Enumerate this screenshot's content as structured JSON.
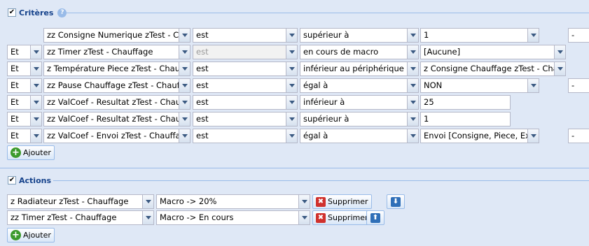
{
  "criteres": {
    "title": "Critères",
    "help_icon": "?",
    "rows": [
      {
        "op": "",
        "var": "zz Consigne Numerique zTest - Ch",
        "comp": "est",
        "cond": "supérieur à",
        "val": "1",
        "extra": "-"
      },
      {
        "op": "Et",
        "var": "zz Timer zTest - Chauffage",
        "comp": "est",
        "cond": "en cours de macro",
        "val": "[Aucune]",
        "extra": ""
      },
      {
        "op": "Et",
        "var": "z Température Piece zTest - Chau",
        "comp": "est",
        "cond": "inférieur au périphérique",
        "val": "z Consigne Chauffage zTest - Chau",
        "extra": ""
      },
      {
        "op": "Et",
        "var": "zz Pause Chauffage zTest - Chauff",
        "comp": "est",
        "cond": "égal à",
        "val": "NON",
        "extra": "-"
      },
      {
        "op": "Et",
        "var": "zz ValCoef - Resultat zTest - Chau",
        "comp": "est",
        "cond": "inférieur à",
        "val": "25",
        "extra": ""
      },
      {
        "op": "Et",
        "var": "zz ValCoef - Resultat zTest - Chau",
        "comp": "est",
        "cond": "supérieur à",
        "val": "1",
        "extra": ""
      },
      {
        "op": "Et",
        "var": "zz ValCoef - Envoi zTest - Chauffac",
        "comp": "est",
        "cond": "égal à",
        "val": "Envoi [Consigne, Piece, Ex",
        "extra": "-"
      }
    ],
    "add_label": "Ajouter"
  },
  "actions": {
    "title": "Actions",
    "rows": [
      {
        "device": "z Radiateur zTest - Chauffage",
        "macro": "Macro -> 20%",
        "delete_label": "Supprimer",
        "move_icon": "arrow-down-icon"
      },
      {
        "device": "zz Timer zTest - Chauffage",
        "macro": "Macro -> En cours",
        "delete_label": "Supprimer",
        "move_icon": "arrow-up-icon"
      }
    ],
    "add_label": "Ajouter"
  }
}
